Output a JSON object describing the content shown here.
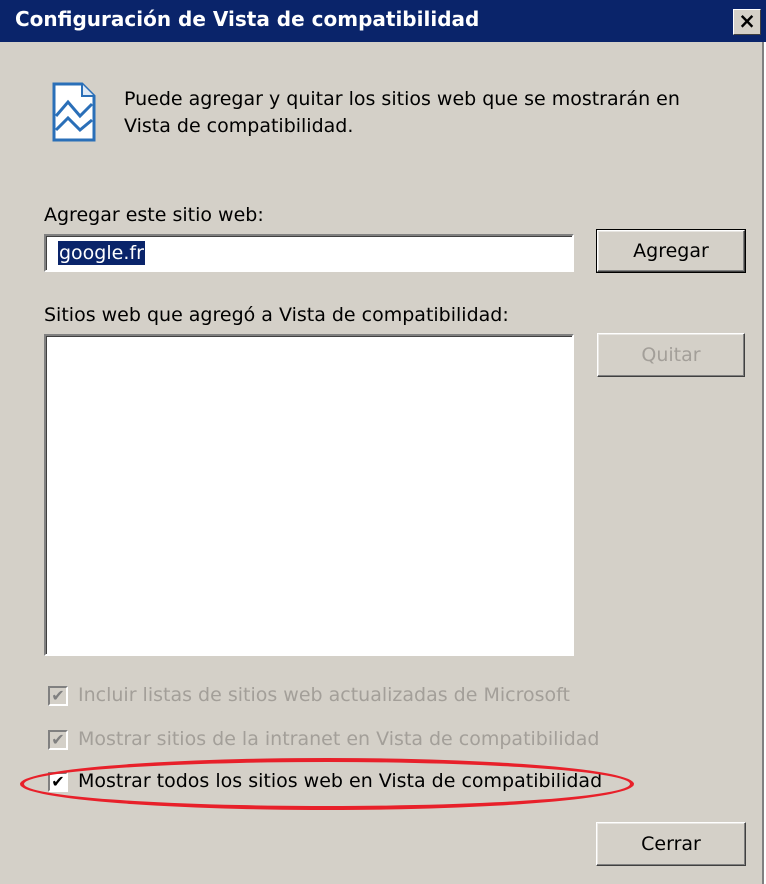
{
  "window": {
    "title": "Configuración de Vista de compatibilidad",
    "close_label": "×"
  },
  "info": {
    "icon": "compat-view-page-icon",
    "line1": "Puede agregar y quitar los sitios web que se mostrarán en",
    "line2": "Vista de compatibilidad."
  },
  "add_site": {
    "label": "Agregar este sitio web:",
    "value": "google.fr",
    "button_label": "Agregar"
  },
  "sites_list": {
    "label": "Sitios web que agregó a Vista de compatibilidad:",
    "items": [],
    "remove_button_label": "Quitar"
  },
  "options": [
    {
      "label": "Incluir listas de sitios web actualizadas de Microsoft",
      "checked": true,
      "enabled": false
    },
    {
      "label": "Mostrar sitios de la intranet en Vista de compatibilidad",
      "checked": true,
      "enabled": false
    },
    {
      "label": "Mostrar todos los sitios web en Vista de compatibilidad",
      "checked": true,
      "enabled": true
    }
  ],
  "footer": {
    "close_button_label": "Cerrar"
  },
  "colors": {
    "title_bar": "#0a246a",
    "dialog_bg": "#d4d0c8",
    "highlight_oval": "#e8202a",
    "disabled_text": "#a39f99"
  }
}
